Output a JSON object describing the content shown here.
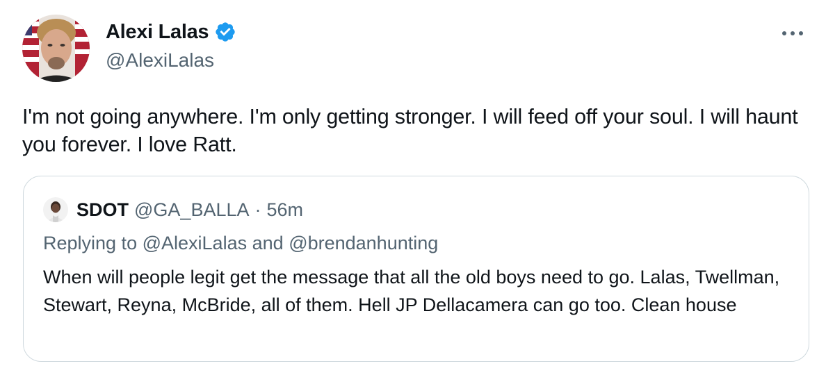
{
  "author": {
    "name": "Alexi Lalas",
    "handle": "@AlexiLalas",
    "verified_color": "#1d9bf0"
  },
  "tweet": {
    "text": "I'm not going anywhere. I'm only getting stronger. I will feed off your soul. I will haunt you forever. I love Ratt."
  },
  "quote": {
    "name": "SDOT",
    "handle": "@GA_BALLA",
    "separator": "·",
    "time": "56m",
    "replying_prefix": "Replying to",
    "reply_mention_1": "@AlexiLalas",
    "reply_conjunction": "and",
    "reply_mention_2": "@brendanhunting",
    "text": "When will people legit get the message that all the old boys need to go. Lalas, Twellman, Stewart, Reyna, McBride, all of them. Hell JP Dellacamera can go too. Clean house"
  },
  "icons": {
    "more": "more-horizontal-icon",
    "verified": "verified-badge-icon"
  },
  "colors": {
    "text_primary": "#0f1419",
    "text_secondary": "#536471",
    "border": "#cfd9de",
    "accent": "#1d9bf0"
  }
}
